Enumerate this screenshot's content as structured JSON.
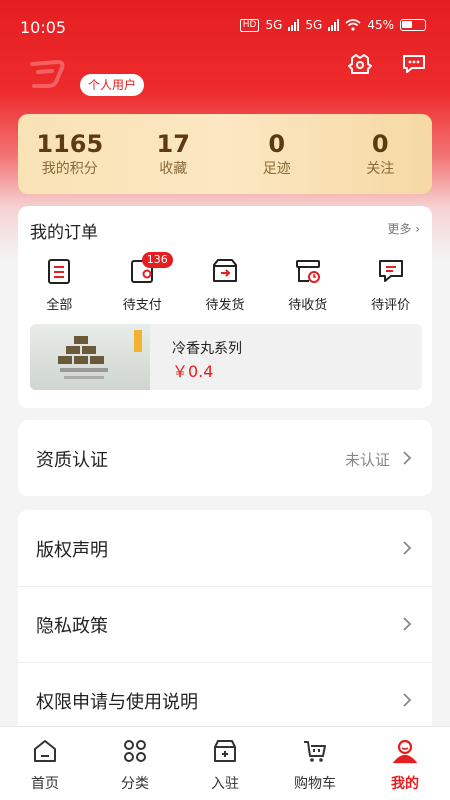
{
  "status": {
    "time": "10:05",
    "battery": "45%",
    "network1": "5G",
    "network2": "5G",
    "hd": "HD"
  },
  "profile": {
    "user_tag": "个人用户"
  },
  "stats": [
    {
      "value": "1165",
      "label": "我的积分"
    },
    {
      "value": "17",
      "label": "收藏"
    },
    {
      "value": "0",
      "label": "足迹"
    },
    {
      "value": "0",
      "label": "关注"
    }
  ],
  "orders": {
    "title": "我的订单",
    "more": "更多",
    "items": [
      {
        "label": "全部",
        "icon": "clipboard-icon"
      },
      {
        "label": "待支付",
        "icon": "wallet-icon",
        "badge": "136"
      },
      {
        "label": "待发货",
        "icon": "truck-box-icon"
      },
      {
        "label": "待收货",
        "icon": "package-clock-icon"
      },
      {
        "label": "待评价",
        "icon": "comment-icon"
      }
    ],
    "promo": {
      "name": "冷香丸系列",
      "price": "￥0.4"
    }
  },
  "certification": {
    "label": "资质认证",
    "status": "未认证"
  },
  "menu": [
    {
      "label": "版权声明"
    },
    {
      "label": "隐私政策"
    },
    {
      "label": "权限申请与使用说明"
    }
  ],
  "tabs": [
    {
      "label": "首页",
      "icon": "home-icon",
      "active": false
    },
    {
      "label": "分类",
      "icon": "grid-icon",
      "active": false
    },
    {
      "label": "入驻",
      "icon": "store-icon",
      "active": false
    },
    {
      "label": "购物车",
      "icon": "cart-icon",
      "active": false
    },
    {
      "label": "我的",
      "icon": "user-icon",
      "active": true
    }
  ],
  "colors": {
    "brand": "#e51e21",
    "gold_bg": "#f9e2b4",
    "gold_text": "#5d3a10"
  }
}
